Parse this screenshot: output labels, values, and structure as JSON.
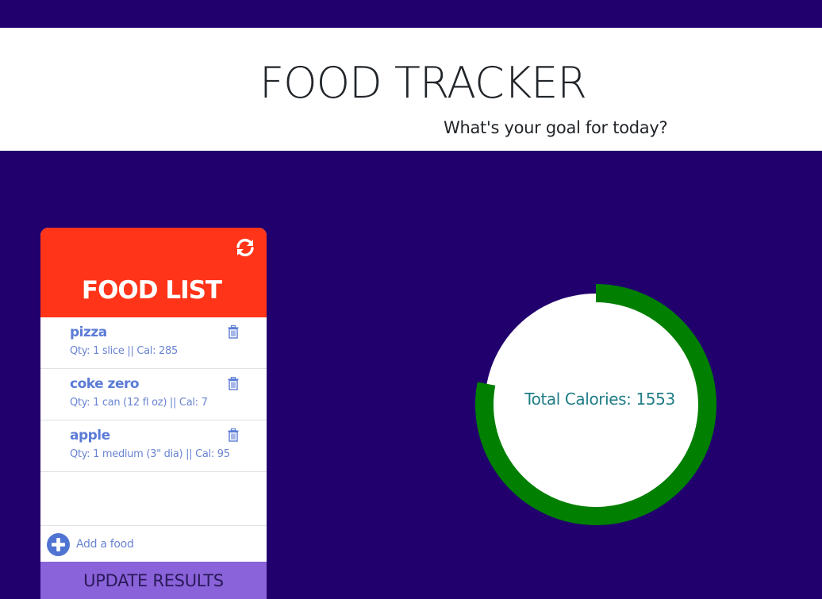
{
  "header": {
    "title": "FOOD TRACKER",
    "subtitle": "What's your goal for today?"
  },
  "food_panel": {
    "title": "FOOD LIST",
    "refresh_icon": "refresh-icon",
    "items": [
      {
        "name": "pizza",
        "detail": "Qty: 1 slice || Cal: 285",
        "delete_icon": "trash-icon"
      },
      {
        "name": "coke zero",
        "detail": "Qty: 1 can (12 fl oz) || Cal: 7",
        "delete_icon": "trash-icon"
      },
      {
        "name": "apple",
        "detail": "Qty: 1 medium (3\" dia) || Cal: 95",
        "delete_icon": "trash-icon"
      }
    ],
    "add_icon": "plus-circle-icon",
    "add_label": "Add a food",
    "update_button": "UPDATE RESULTS"
  },
  "calorie_ring": {
    "label": "Total Calories: 1553",
    "progress": 0.78,
    "ring_color": "#007f00",
    "fill_color": "#ffffff"
  },
  "colors": {
    "background": "#21006e",
    "panel_header": "#ff3419",
    "accent_text": "#5b7bd6",
    "update_button": "#8a62d9"
  }
}
